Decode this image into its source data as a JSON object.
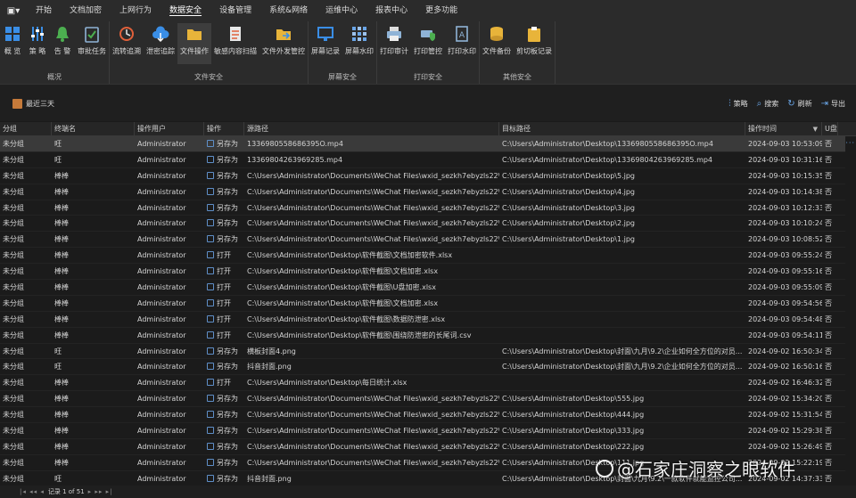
{
  "menubar": {
    "icon": "app-menu-icon",
    "items": [
      "开始",
      "文档加密",
      "上网行为",
      "数据安全",
      "设备管理",
      "系统&网络",
      "运维中心",
      "报表中心",
      "更多功能"
    ],
    "active": "数据安全"
  },
  "ribbon": {
    "groups": [
      {
        "caption": "概况",
        "buttons": [
          {
            "label": "概 览",
            "icon": "grid-icon",
            "color": "#3a8ee6"
          },
          {
            "label": "策 略",
            "icon": "sliders-icon",
            "color": "#3a8ee6"
          },
          {
            "label": "告 警",
            "icon": "bell-icon",
            "color": "#4caf50"
          },
          {
            "label": "审批任务",
            "icon": "clipboard-check-icon",
            "color": "#8fb3d6"
          }
        ]
      },
      {
        "caption": "文件安全",
        "buttons": [
          {
            "label": "流转追溯",
            "icon": "trace-icon",
            "color": "#e0603a"
          },
          {
            "label": "泄密追踪",
            "icon": "cloud-icon",
            "color": "#3a8ee6"
          },
          {
            "label": "文件操作",
            "icon": "folder-icon",
            "color": "#e8b43a",
            "selected": true
          },
          {
            "label": "敏感内容扫描",
            "icon": "document-scan-icon",
            "color": "#e0603a"
          },
          {
            "label": "文件外发管控",
            "icon": "folder-send-icon",
            "color": "#e8b43a"
          }
        ]
      },
      {
        "caption": "屏幕安全",
        "buttons": [
          {
            "label": "屏幕记录",
            "icon": "monitor-icon",
            "color": "#3a8ee6"
          },
          {
            "label": "屏幕水印",
            "icon": "watermark-grid-icon",
            "color": "#6aa6e8"
          }
        ]
      },
      {
        "caption": "打印安全",
        "buttons": [
          {
            "label": "打印审计",
            "icon": "printer-icon",
            "color": "#8fb3d6"
          },
          {
            "label": "打印管控",
            "icon": "printer-shield-icon",
            "color": "#4caf50"
          },
          {
            "label": "打印水印",
            "icon": "document-a-icon",
            "color": "#8fb3d6"
          }
        ]
      },
      {
        "caption": "其他安全",
        "buttons": [
          {
            "label": "文件备份",
            "icon": "database-icon",
            "color": "#e8b43a"
          },
          {
            "label": "剪切板记录",
            "icon": "clipboard-icon",
            "color": "#e8b43a"
          }
        ]
      }
    ]
  },
  "toolbar": {
    "recent": "最近三天",
    "tools": [
      {
        "label": "策略",
        "icon": "strategy-icon"
      },
      {
        "label": "搜索",
        "icon": "search-icon"
      },
      {
        "label": "刷新",
        "icon": "refresh-icon"
      },
      {
        "label": "导出",
        "icon": "export-icon"
      }
    ]
  },
  "table": {
    "columns": [
      "分组",
      "终端名",
      "操作用户",
      "操作",
      "源路径",
      "目标路径",
      "操作时间",
      "U盘"
    ],
    "rows": [
      [
        "未分组",
        "旺",
        "Administrator",
        "另存为",
        "1336980558686395O.mp4",
        "C:\\Users\\Administrator\\Desktop\\1336980558686395O.mp4",
        "2024-09-03 10:53:09",
        "否"
      ],
      [
        "未分组",
        "旺",
        "Administrator",
        "另存为",
        "13369804263969285.mp4",
        "C:\\Users\\Administrator\\Desktop\\13369804263969285.mp4",
        "2024-09-03 10:31:16",
        "否"
      ],
      [
        "未分组",
        "棒棒",
        "Administrator",
        "另存为",
        "C:\\Users\\Administrator\\Documents\\WeChat Files\\wxid_sezkh7ebyzls22\\...",
        "C:\\Users\\Administrator\\Desktop\\5.jpg",
        "2024-09-03 10:15:35",
        "否"
      ],
      [
        "未分组",
        "棒棒",
        "Administrator",
        "另存为",
        "C:\\Users\\Administrator\\Documents\\WeChat Files\\wxid_sezkh7ebyzls22\\...",
        "C:\\Users\\Administrator\\Desktop\\4.jpg",
        "2024-09-03 10:14:38",
        "否"
      ],
      [
        "未分组",
        "棒棒",
        "Administrator",
        "另存为",
        "C:\\Users\\Administrator\\Documents\\WeChat Files\\wxid_sezkh7ebyzls22\\...",
        "C:\\Users\\Administrator\\Desktop\\3.jpg",
        "2024-09-03 10:12:33",
        "否"
      ],
      [
        "未分组",
        "棒棒",
        "Administrator",
        "另存为",
        "C:\\Users\\Administrator\\Documents\\WeChat Files\\wxid_sezkh7ebyzls22\\...",
        "C:\\Users\\Administrator\\Desktop\\2.jpg",
        "2024-09-03 10:10:24",
        "否"
      ],
      [
        "未分组",
        "棒棒",
        "Administrator",
        "另存为",
        "C:\\Users\\Administrator\\Documents\\WeChat Files\\wxid_sezkh7ebyzls22\\...",
        "C:\\Users\\Administrator\\Desktop\\1.jpg",
        "2024-09-03 10:08:52",
        "否"
      ],
      [
        "未分组",
        "棒棒",
        "Administrator",
        "打开",
        "C:\\Users\\Administrator\\Desktop\\软件截图\\文档加密软件.xlsx",
        "",
        "2024-09-03 09:55:24",
        "否"
      ],
      [
        "未分组",
        "棒棒",
        "Administrator",
        "打开",
        "C:\\Users\\Administrator\\Desktop\\软件截图\\文档加密.xlsx",
        "",
        "2024-09-03 09:55:16",
        "否"
      ],
      [
        "未分组",
        "棒棒",
        "Administrator",
        "打开",
        "C:\\Users\\Administrator\\Desktop\\软件截图\\U盘加密.xlsx",
        "",
        "2024-09-03 09:55:09",
        "否"
      ],
      [
        "未分组",
        "棒棒",
        "Administrator",
        "打开",
        "C:\\Users\\Administrator\\Desktop\\软件截图\\文档加密.xlsx",
        "",
        "2024-09-03 09:54:56",
        "否"
      ],
      [
        "未分组",
        "棒棒",
        "Administrator",
        "打开",
        "C:\\Users\\Administrator\\Desktop\\软件截图\\数据防泄密.xlsx",
        "",
        "2024-09-03 09:54:48",
        "否"
      ],
      [
        "未分组",
        "棒棒",
        "Administrator",
        "打开",
        "C:\\Users\\Administrator\\Desktop\\软件截图\\围绕防泄密的长尾词.csv",
        "",
        "2024-09-03 09:54:11",
        "否"
      ],
      [
        "未分组",
        "旺",
        "Administrator",
        "另存为",
        "横板封面4.png",
        "C:\\Users\\Administrator\\Desktop\\封面\\九月\\9.2\\企业如何全方位的对员...",
        "2024-09-02 16:50:34",
        "否"
      ],
      [
        "未分组",
        "旺",
        "Administrator",
        "另存为",
        "抖音封面.png",
        "C:\\Users\\Administrator\\Desktop\\封面\\九月\\9.2\\企业如何全方位的对员...",
        "2024-09-02 16:50:16",
        "否"
      ],
      [
        "未分组",
        "棒棒",
        "Administrator",
        "打开",
        "C:\\Users\\Administrator\\Desktop\\每日统计.xlsx",
        "",
        "2024-09-02 16:46:32",
        "否"
      ],
      [
        "未分组",
        "棒棒",
        "Administrator",
        "另存为",
        "C:\\Users\\Administrator\\Documents\\WeChat Files\\wxid_sezkh7ebyzls22\\...",
        "C:\\Users\\Administrator\\Desktop\\555.jpg",
        "2024-09-02 15:34:20",
        "否"
      ],
      [
        "未分组",
        "棒棒",
        "Administrator",
        "另存为",
        "C:\\Users\\Administrator\\Documents\\WeChat Files\\wxid_sezkh7ebyzls22\\...",
        "C:\\Users\\Administrator\\Desktop\\444.jpg",
        "2024-09-02 15:31:54",
        "否"
      ],
      [
        "未分组",
        "棒棒",
        "Administrator",
        "另存为",
        "C:\\Users\\Administrator\\Documents\\WeChat Files\\wxid_sezkh7ebyzls22\\...",
        "C:\\Users\\Administrator\\Desktop\\333.jpg",
        "2024-09-02 15:29:38",
        "否"
      ],
      [
        "未分组",
        "棒棒",
        "Administrator",
        "另存为",
        "C:\\Users\\Administrator\\Documents\\WeChat Files\\wxid_sezkh7ebyzls22\\...",
        "C:\\Users\\Administrator\\Desktop\\222.jpg",
        "2024-09-02 15:26:49",
        "否"
      ],
      [
        "未分组",
        "棒棒",
        "Administrator",
        "另存为",
        "C:\\Users\\Administrator\\Documents\\WeChat Files\\wxid_sezkh7ebyzls22\\...",
        "C:\\Users\\Administrator\\Desktop\\111.jpg",
        "2024-09-02 15:22:19",
        "否"
      ],
      [
        "未分组",
        "旺",
        "Administrator",
        "另存为",
        "抖音封面.png",
        "C:\\Users\\Administrator\\Desktop\\封面\\九月\\9.2\\一款软件就能监控公司...",
        "2024-09-02 14:37:33",
        "否"
      ]
    ],
    "more": "···"
  },
  "footer": {
    "record": "记录 1 of 51"
  },
  "watermark": "@石家庄洞察之眼软件"
}
